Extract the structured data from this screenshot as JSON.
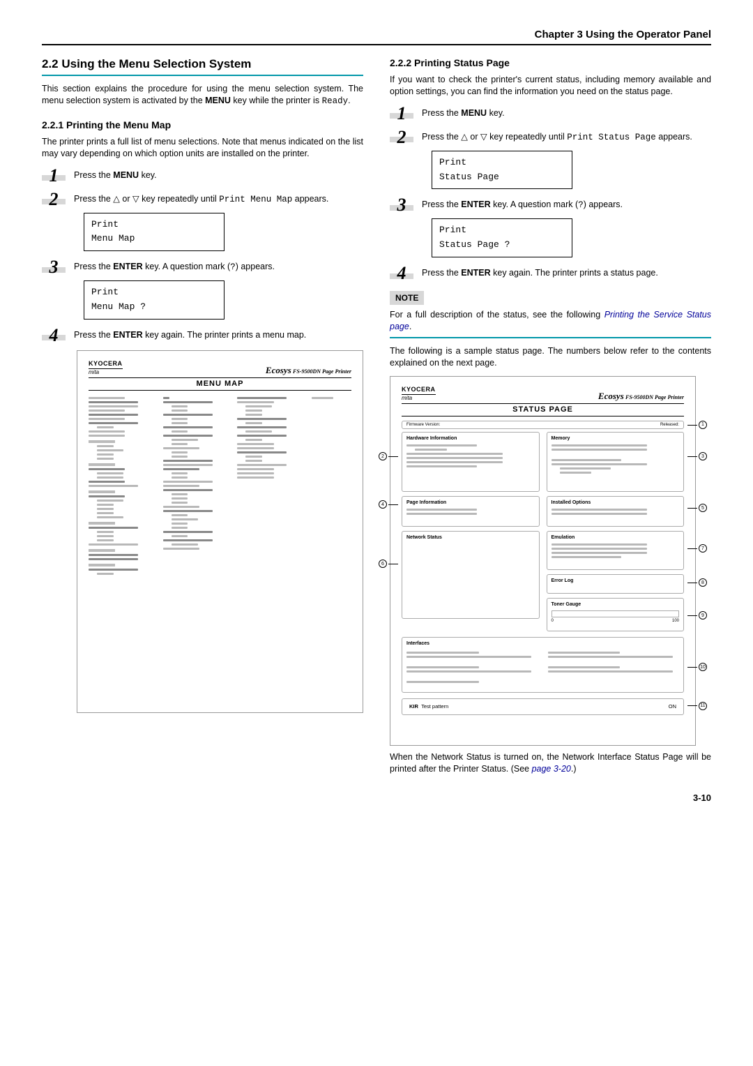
{
  "chapter_header": "Chapter 3  Using the Operator Panel",
  "left": {
    "h2": "2.2 Using the Menu Selection System",
    "intro_a": "This section explains the procedure for using the menu selection system. The menu selection system is activated by the ",
    "intro_b": "MENU",
    "intro_c": " key while the printer is ",
    "intro_ready": "Ready",
    "intro_d": ".",
    "h3": "2.2.1 Printing the Menu Map",
    "p1": "The printer prints a full list of menu selections. Note that menus indicated on the list may vary depending on which option units are installed on the printer.",
    "s1_a": "Press the ",
    "s1_b": "MENU",
    "s1_c": " key.",
    "s2_a": "Press the ",
    "s2_tri1": "△",
    "s2_or": " or ",
    "s2_tri2": "▽",
    "s2_b": " key repeatedly until ",
    "s2_mono": "Print Menu Map",
    "s2_c": " appears.",
    "lcd1_l1": "Print",
    "lcd1_l2": " Menu Map",
    "s3_a": "Press the ",
    "s3_b": "ENTER",
    "s3_c": " key. A question mark (",
    "s3_q": "?",
    "s3_d": ") appears.",
    "lcd2_l1": "Print",
    "lcd2_l2": " Menu Map ?",
    "s4_a": "Press the ",
    "s4_b": "ENTER",
    "s4_c": " key again. The printer prints a menu map.",
    "sample": {
      "brand": "KYOCERA",
      "brand_sub": "mita",
      "ecosys": "Ecosys",
      "model": "FS-9500DN Page Printer",
      "title": "MENU MAP"
    }
  },
  "right": {
    "h3": "2.2.2 Printing Status Page",
    "p1": "If you want to check the printer's current status, including memory available and option settings, you can find the information you need on the status page.",
    "s1_a": "Press the ",
    "s1_b": "MENU",
    "s1_c": " key.",
    "s2_a": "Press the ",
    "s2_tri1": "△",
    "s2_or": " or ",
    "s2_tri2": "▽",
    "s2_b": " key repeatedly until ",
    "s2_mono": "Print Status Page",
    "s2_c": " appears.",
    "lcd1_l1": "Print",
    "lcd1_l2": " Status Page",
    "s3_a": "Press the ",
    "s3_b": "ENTER",
    "s3_c": " key. A question mark (",
    "s3_q": "?",
    "s3_d": ") appears.",
    "lcd2_l1": "Print",
    "lcd2_l2": " Status Page  ?",
    "s4_a": "Press the ",
    "s4_b": "ENTER",
    "s4_c": " key again. The printer prints a status page.",
    "note_label": "NOTE",
    "note_a": "For a full description of the status, see the following ",
    "note_link": "Printing the Service Status page",
    "note_b": ".",
    "p2": "The following is a sample status page. The numbers below refer to the contents explained on the next page.",
    "sample": {
      "brand": "KYOCERA",
      "brand_sub": "mita",
      "ecosys": "Ecosys",
      "model": "FS-9500DN Page Printer",
      "title": "STATUS PAGE",
      "topbar_l": "Firmware Version:",
      "topbar_r": "Released:",
      "box_hw": "Hardware Information",
      "box_mem": "Memory",
      "box_page": "Page Information",
      "box_opt": "Installed Options",
      "box_net": "Network Status",
      "box_emu": "Emulation",
      "box_err": "Error Log",
      "box_toner": "Toner Gauge",
      "gauge_0": "0",
      "gauge_100": "100",
      "box_if": "Interfaces",
      "kir_l": "KIR  Test pattern",
      "kir_r": "ON",
      "c1": "1",
      "c2": "2",
      "c3": "3",
      "c4": "4",
      "c5": "5",
      "c6": "6",
      "c7": "7",
      "c8": "8",
      "c9": "9",
      "c10": "10",
      "c11": "11"
    },
    "p3_a": "When the Network Status is turned on, the Network Interface Status Page will be printed after the Printer Status. (See ",
    "p3_link": " page 3-20",
    "p3_b": ".)"
  },
  "page_num": "3-10"
}
